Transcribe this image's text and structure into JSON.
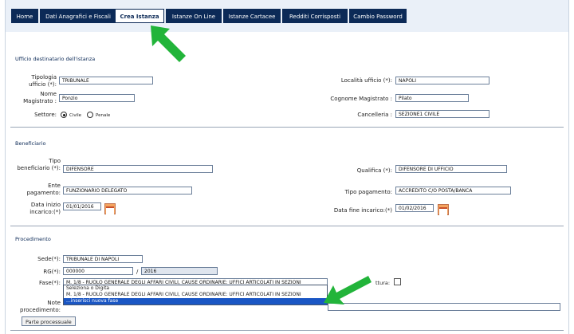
{
  "nav": {
    "tabs": [
      "Home",
      "Dati Anagrafici e Fiscali",
      "Crea Istanza",
      "Istanze On Line",
      "Istanze Cartacee",
      "Redditi Corrisposti",
      "Cambio Password"
    ],
    "active": "Crea Istanza"
  },
  "ufficio": {
    "section_title": "Ufficio destinatario dell'istanza",
    "tipologia_label": "Tipologia ufficio (*):",
    "tipologia_value": "TRIBUNALE",
    "localita_label": "Località ufficio (*):",
    "localita_value": "NAPOLI",
    "nome_label": "Nome Magistrato :",
    "nome_value": "Ponzio",
    "cognome_label": "Cognome Magistrato :",
    "cognome_value": "Pilato",
    "settore_label": "Settore:",
    "settore_options": [
      "Civile",
      "Penale"
    ],
    "settore_selected": "Civile",
    "cancelleria_label": "Cancelleria :",
    "cancelleria_value": "SEZIONE1 CIVILE"
  },
  "beneficiario": {
    "section_title": "Beneficiario",
    "tipo_label": "Tipo beneficiario (*):",
    "tipo_value": "DIFENSORE",
    "qualifica_label": "Qualifica (*):",
    "qualifica_value": "DIFENSORE DI UFFICIO",
    "ente_label": "Ente pagamento:",
    "ente_value": "FUNZIONARIO DELEGATO",
    "tipo_pag_label": "Tipo pagamento:",
    "tipo_pag_value": "ACCREDITO C/O POSTA/BANCA",
    "data_inizio_label": "Data inizio incarico:(*)",
    "data_inizio_value": "01/01/2016",
    "data_fine_label": "Data fine incarico:(*)",
    "data_fine_value": "01/02/2016"
  },
  "procedimento": {
    "section_title": "Procedimento",
    "sede_label": "Sede(*):",
    "sede_value": "TRIBUNALE DI NAPOLI",
    "rg_label": "RG(*):",
    "rg_value": "000000",
    "rg_sep": "/",
    "rg_year": "2016",
    "fase_label": "Fase(*):",
    "fase_value": "M. 1/8 - RUOLO GENERALE DEGLI AFFARI CIVILI, CAUSE ORDINARIE: UFFICI ARTICOLATI IN SEZIONI",
    "fase_options": [
      "Seleziona o Digita",
      "M. 1/8 - RUOLO GENERALE DEGLI AFFARI CIVILI, CAUSE ORDINARIE: UFFICI ARTICOLATI IN SEZIONI",
      "...inserisci nuova fase"
    ],
    "fase_highlighted": "...inserisci nuova fase",
    "note_label": "Note procedimento:",
    "right_label_partial": "ttura:",
    "button_label": "Parte processuale"
  },
  "colors": {
    "nav_bg": "#0c2a57",
    "accent_arrow": "#22b43a",
    "dropdown_highlight": "#1a56c4"
  }
}
